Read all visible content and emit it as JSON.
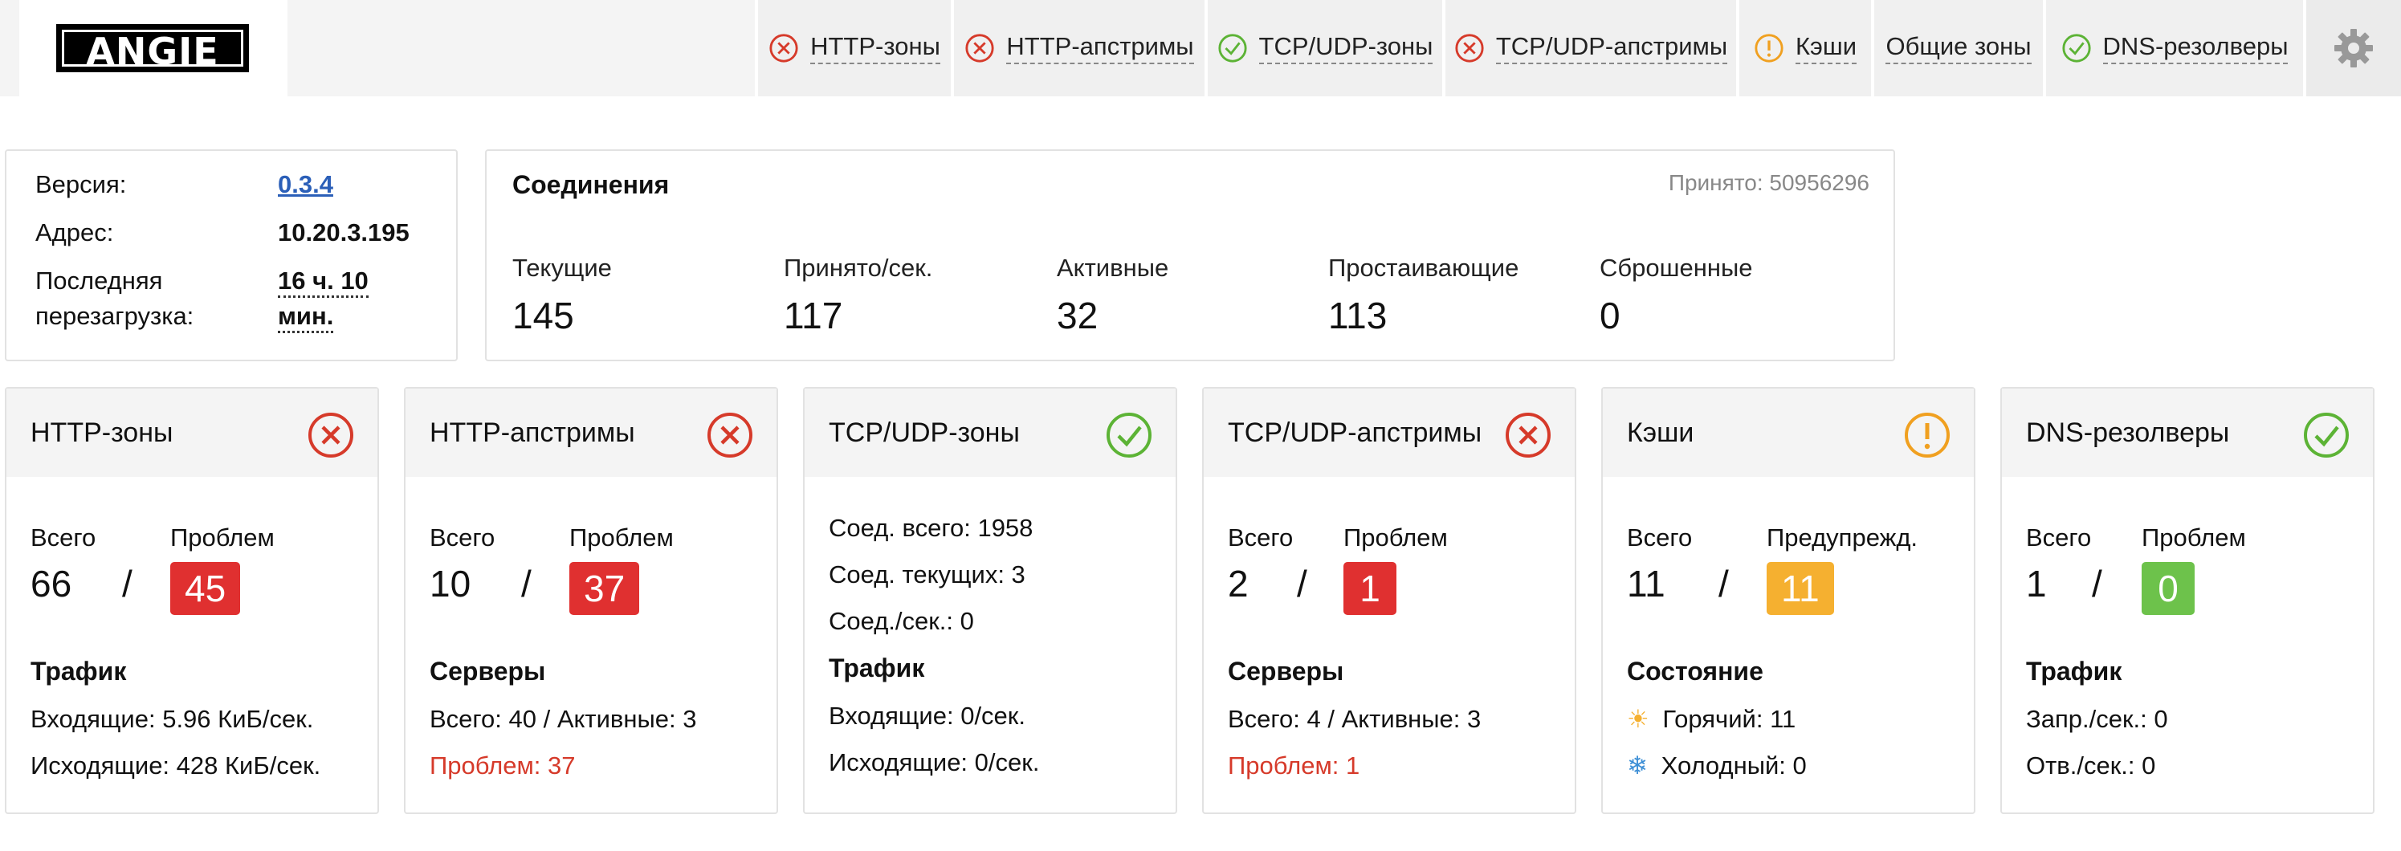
{
  "logo_text": "ANGIE",
  "nav": [
    {
      "label": "HTTP-зоны",
      "status": "error"
    },
    {
      "label": "HTTP-апстримы",
      "status": "error"
    },
    {
      "label": "TCP/UDP-зоны",
      "status": "ok"
    },
    {
      "label": "TCP/UDP-апстримы",
      "status": "error"
    },
    {
      "label": "Кэши",
      "status": "warning"
    },
    {
      "label": "Общие зоны",
      "status": "none"
    },
    {
      "label": "DNS-резолверы",
      "status": "ok"
    }
  ],
  "info": {
    "version_label": "Версия:",
    "version_value": "0.3.4",
    "address_label": "Адрес:",
    "address_value": "10.20.3.195",
    "reload_label_1": "Последняя",
    "reload_label_2": "перезагрузка:",
    "reload_value_1": "16 ч. 10",
    "reload_value_2": "мин."
  },
  "connections": {
    "title": "Соединения",
    "accepted": "Принято: 50956296",
    "columns": [
      {
        "label": "Текущие",
        "value": "145"
      },
      {
        "label": "Принято/сек.",
        "value": "117"
      },
      {
        "label": "Активные",
        "value": "32"
      },
      {
        "label": "Простаивающие",
        "value": "113"
      },
      {
        "label": "Сброшенные",
        "value": "0"
      }
    ]
  },
  "cards": {
    "http_zones": {
      "title": "HTTP-зоны",
      "status": "error",
      "total_label": "Всего",
      "problem_label": "Проблем",
      "total": "66",
      "slash": "/",
      "problems": "45",
      "section": "Трафик",
      "line1": "Входящие: 5.96 КиБ/сек.",
      "line2": "Исходящие: 428 КиБ/сек."
    },
    "http_upstreams": {
      "title": "HTTP-апстримы",
      "status": "error",
      "total_label": "Всего",
      "problem_label": "Проблем",
      "total": "10",
      "slash": "/",
      "problems": "37",
      "section": "Серверы",
      "line1": "Всего: 40 / Активные: 3",
      "line2": "Проблем: 37"
    },
    "tcp_zones": {
      "title": "TCP/UDP-зоны",
      "status": "ok",
      "line_a": "Соед. всего: 1958",
      "line_b": "Соед. текущих: 3",
      "line_c": "Соед./сек.: 0",
      "section": "Трафик",
      "line1": "Входящие: 0/сек.",
      "line2": "Исходящие: 0/сек."
    },
    "tcp_upstreams": {
      "title": "TCP/UDP-апстримы",
      "status": "error",
      "total_label": "Всего",
      "problem_label": "Проблем",
      "total": "2",
      "slash": "/",
      "problems": "1",
      "section": "Серверы",
      "line1": "Всего: 4 / Активные: 3",
      "line2": "Проблем: 1"
    },
    "caches": {
      "title": "Кэши",
      "status": "warning",
      "total_label": "Всего",
      "problem_label": "Предупрежд.",
      "total": "11",
      "slash": "/",
      "problems": "11",
      "section": "Состояние",
      "hot_icon": "☀",
      "cold_icon": "❄",
      "line1": "Горячий: 11",
      "line2": "Холодный: 0"
    },
    "dns": {
      "title": "DNS-резолверы",
      "status": "ok",
      "total_label": "Всего",
      "problem_label": "Проблем",
      "total": "1",
      "slash": "/",
      "problems": "0",
      "section": "Трафик",
      "line1": "Запр./сек.: 0",
      "line2": "Отв./сек.: 0"
    }
  },
  "colors": {
    "error": "#e03030",
    "warning": "#f5b030",
    "ok": "#6dc24b",
    "link": "#2b5fb8"
  }
}
